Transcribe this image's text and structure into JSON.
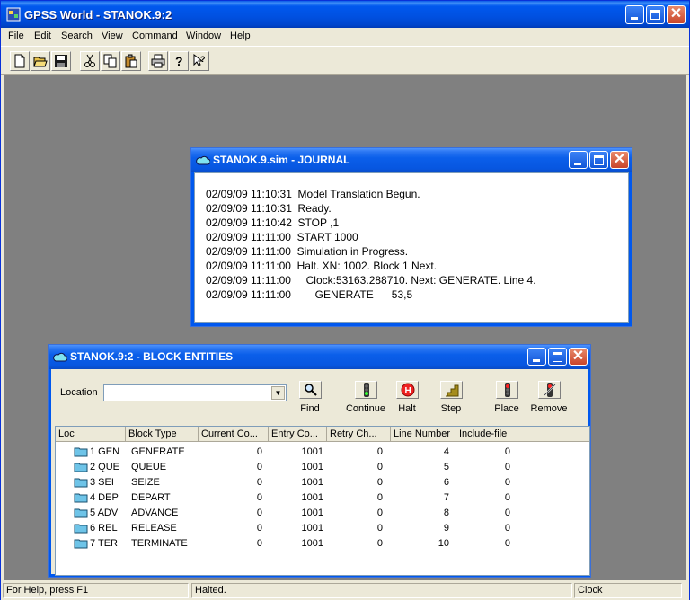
{
  "app": {
    "title": "GPSS World - STANOK.9:2"
  },
  "menu": [
    "File",
    "Edit",
    "Search",
    "View",
    "Command",
    "Window",
    "Help"
  ],
  "toolbar": [
    "new-icon",
    "open-icon",
    "save-icon",
    "cut-icon",
    "copy-icon",
    "paste-icon",
    "print-icon",
    "help-icon",
    "context-help-icon"
  ],
  "journal": {
    "title": "STANOK.9.sim  -  JOURNAL",
    "lines": [
      "02/09/09 11:10:31  Model Translation Begun.",
      "02/09/09 11:10:31  Ready.",
      "02/09/09 11:10:42  STOP ,1",
      "02/09/09 11:11:00  START 1000",
      "02/09/09 11:11:00  Simulation in Progress.",
      "02/09/09 11:11:00  Halt. XN: 1002. Block 1 Next.",
      "02/09/09 11:11:00     Clock:53163.288710. Next: GENERATE. Line 4.",
      "02/09/09 11:11:00        GENERATE      53,5"
    ]
  },
  "blocks": {
    "title": "STANOK.9:2  -  BLOCK ENTITIES",
    "location_label": "Location",
    "location_value": "",
    "buttons": {
      "find": "Find",
      "continue": "Continue",
      "halt": "Halt",
      "step": "Step",
      "place": "Place",
      "remove": "Remove"
    },
    "columns": [
      "Loc",
      "Block Type",
      "Current Co...",
      "Entry Co...",
      "Retry Ch...",
      "Line Number",
      "Include-file"
    ],
    "rows": [
      {
        "loc": "1 GEN",
        "type": "GENERATE",
        "current": "0",
        "entry": "1001",
        "retry": "0",
        "line": "4",
        "include": "0"
      },
      {
        "loc": "2 QUE",
        "type": "QUEUE",
        "current": "0",
        "entry": "1001",
        "retry": "0",
        "line": "5",
        "include": "0"
      },
      {
        "loc": "3 SEI",
        "type": "SEIZE",
        "current": "0",
        "entry": "1001",
        "retry": "0",
        "line": "6",
        "include": "0"
      },
      {
        "loc": "4 DEP",
        "type": "DEPART",
        "current": "0",
        "entry": "1001",
        "retry": "0",
        "line": "7",
        "include": "0"
      },
      {
        "loc": "5 ADV",
        "type": "ADVANCE",
        "current": "0",
        "entry": "1001",
        "retry": "0",
        "line": "8",
        "include": "0"
      },
      {
        "loc": "6 REL",
        "type": "RELEASE",
        "current": "0",
        "entry": "1001",
        "retry": "0",
        "line": "9",
        "include": "0"
      },
      {
        "loc": "7 TER",
        "type": "TERMINATE",
        "current": "0",
        "entry": "1001",
        "retry": "0",
        "line": "10",
        "include": "0"
      }
    ]
  },
  "status": {
    "help": "For Help, press F1",
    "state": "Halted.",
    "clock": "Clock"
  }
}
